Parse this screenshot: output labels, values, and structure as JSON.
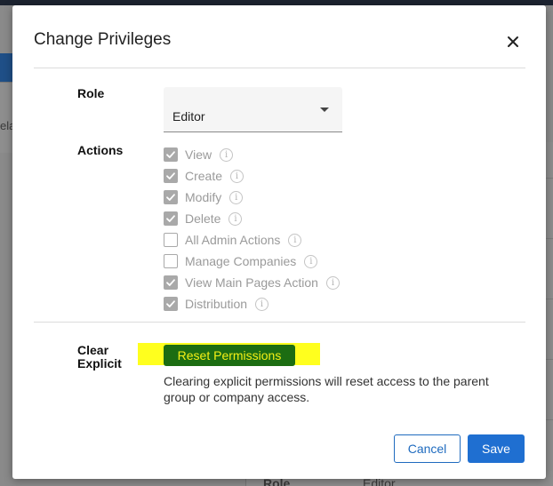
{
  "background": {
    "left_text": "ela",
    "bottom_role_label": "Role",
    "bottom_role_value": "Editor"
  },
  "modal": {
    "title": "Change Privileges",
    "role": {
      "label": "Role",
      "value": "Editor"
    },
    "actions": {
      "label": "Actions",
      "items": [
        {
          "label": "View",
          "checked": true
        },
        {
          "label": "Create",
          "checked": true
        },
        {
          "label": "Modify",
          "checked": true
        },
        {
          "label": "Delete",
          "checked": true
        },
        {
          "label": "All Admin Actions",
          "checked": false
        },
        {
          "label": "Manage Companies",
          "checked": false
        },
        {
          "label": "View Main Pages Action",
          "checked": true
        },
        {
          "label": "Distribution",
          "checked": true
        }
      ]
    },
    "clear_explicit": {
      "label_line1": "Clear",
      "label_line2": "Explicit",
      "button_label": "Reset Permissions",
      "note": "Clearing explicit permissions will reset access to the parent group or company access."
    },
    "footer": {
      "cancel_label": "Cancel",
      "save_label": "Save"
    }
  },
  "colors": {
    "accent": "#1f6fd1",
    "reset_button_bg": "#1c6d12",
    "highlight": "#ffff1e"
  }
}
